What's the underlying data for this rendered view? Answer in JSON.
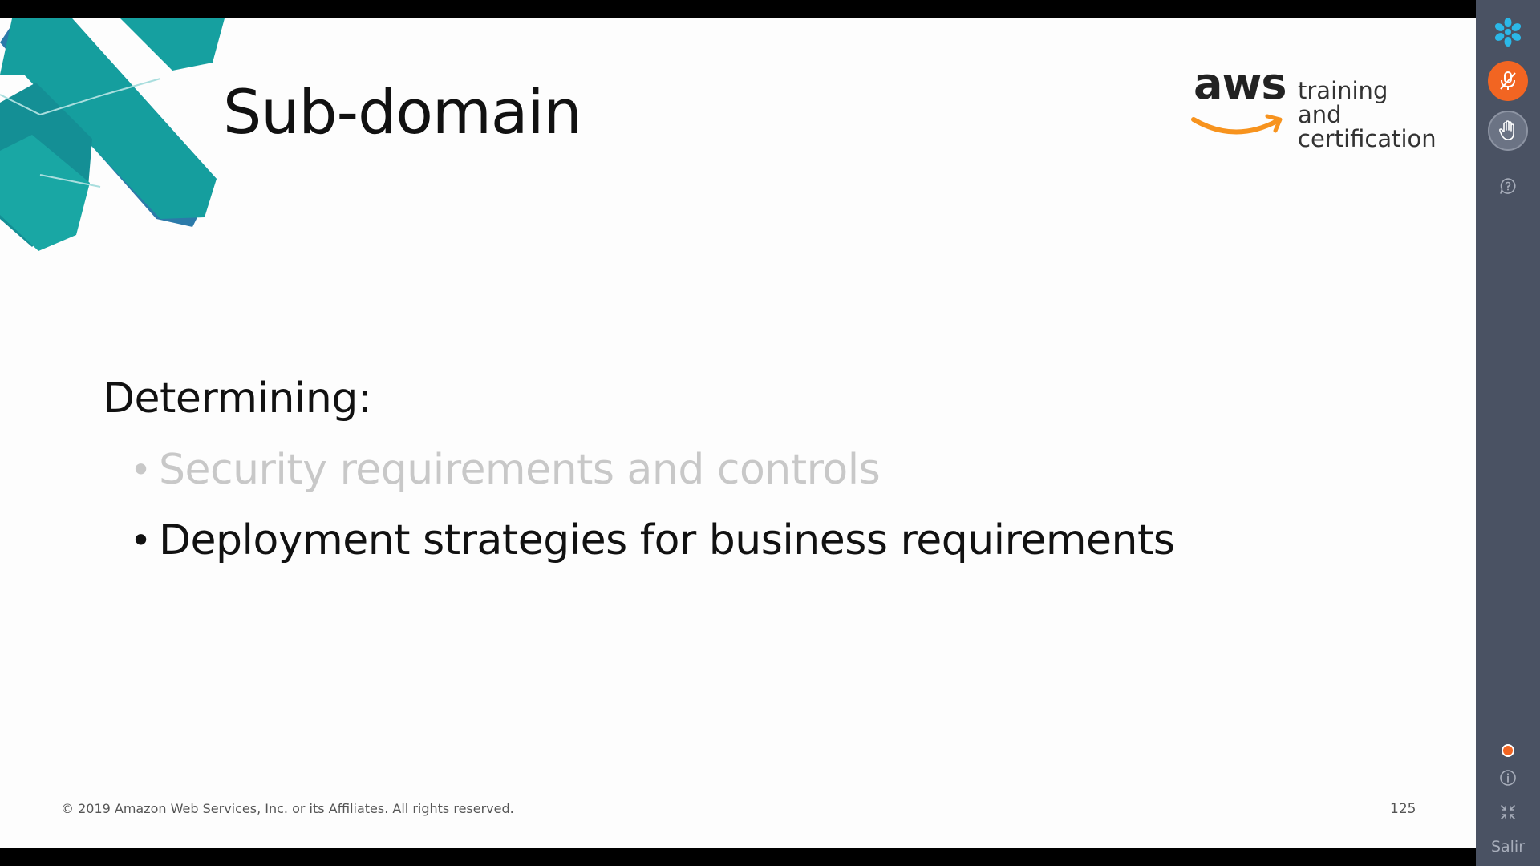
{
  "slide": {
    "title": "Sub-domain",
    "logo": {
      "word": "aws",
      "tagline_line1": "training and",
      "tagline_line2": "certification"
    },
    "intro": "Determining:",
    "bullets": [
      {
        "text": "Security requirements and controls",
        "state": "dimmed"
      },
      {
        "text": "Deployment strategies for business requirements",
        "state": "active"
      }
    ],
    "footer": "© 2019 Amazon Web Services, Inc. or its Affiliates. All rights reserved.",
    "page_number": "125"
  },
  "sidebar": {
    "buttons": [
      {
        "icon": "snowflake-logo-icon"
      },
      {
        "icon": "microphone-muted-icon"
      },
      {
        "icon": "raise-hand-icon"
      },
      {
        "icon": "help-chat-icon"
      },
      {
        "icon": "status-dot-icon"
      },
      {
        "icon": "info-icon"
      },
      {
        "icon": "collapse-icon"
      }
    ],
    "exit_label": "Salir"
  },
  "colors": {
    "accent_teal": "#17a5a5",
    "accent_blue": "#2d6ba5",
    "aws_orange": "#f7931e",
    "mic_orange": "#f26522",
    "sidebar_bg": "#4a5263",
    "logo_cyan": "#2bb8e8"
  }
}
